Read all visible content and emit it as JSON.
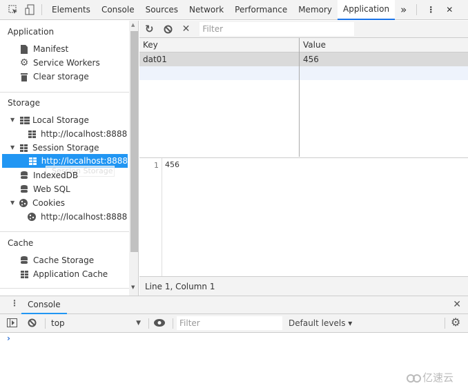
{
  "topbar": {
    "tabs": [
      "Elements",
      "Console",
      "Sources",
      "Network",
      "Performance",
      "Memory",
      "Application"
    ],
    "active": "Application",
    "more": "»",
    "menu": "⋮",
    "close": "✕"
  },
  "sidebar": {
    "application_header": "Application",
    "application_items": [
      "Manifest",
      "Service Workers",
      "Clear storage"
    ],
    "storage_header": "Storage",
    "local_storage": "Local Storage",
    "local_origin": "http://localhost:8888",
    "session_storage": "Session Storage",
    "session_origin": "http://localhost:8888",
    "drag_ghost": "Session Storage",
    "indexeddb": "IndexedDB",
    "websql": "Web SQL",
    "cookies": "Cookies",
    "cookies_origin": "http://localhost:8888",
    "cache_header": "Cache",
    "cache_items": [
      "Cache Storage",
      "Application Cache"
    ]
  },
  "storage_table": {
    "filter_placeholder": "Filter",
    "columns": [
      "Key",
      "Value"
    ],
    "rows": [
      {
        "key": "dat01",
        "value": "456"
      }
    ]
  },
  "editor": {
    "line_number": "1",
    "content": "456",
    "status": "Line 1, Column 1"
  },
  "drawer": {
    "tab": "Console",
    "close": "✕"
  },
  "console": {
    "context": "top",
    "filter_placeholder": "Filter",
    "levels": "Default levels ▾",
    "prompt": "›"
  },
  "watermark": "亿速云",
  "colors": {
    "accent": "#2196f3",
    "toolbar": "#f3f3f3"
  }
}
